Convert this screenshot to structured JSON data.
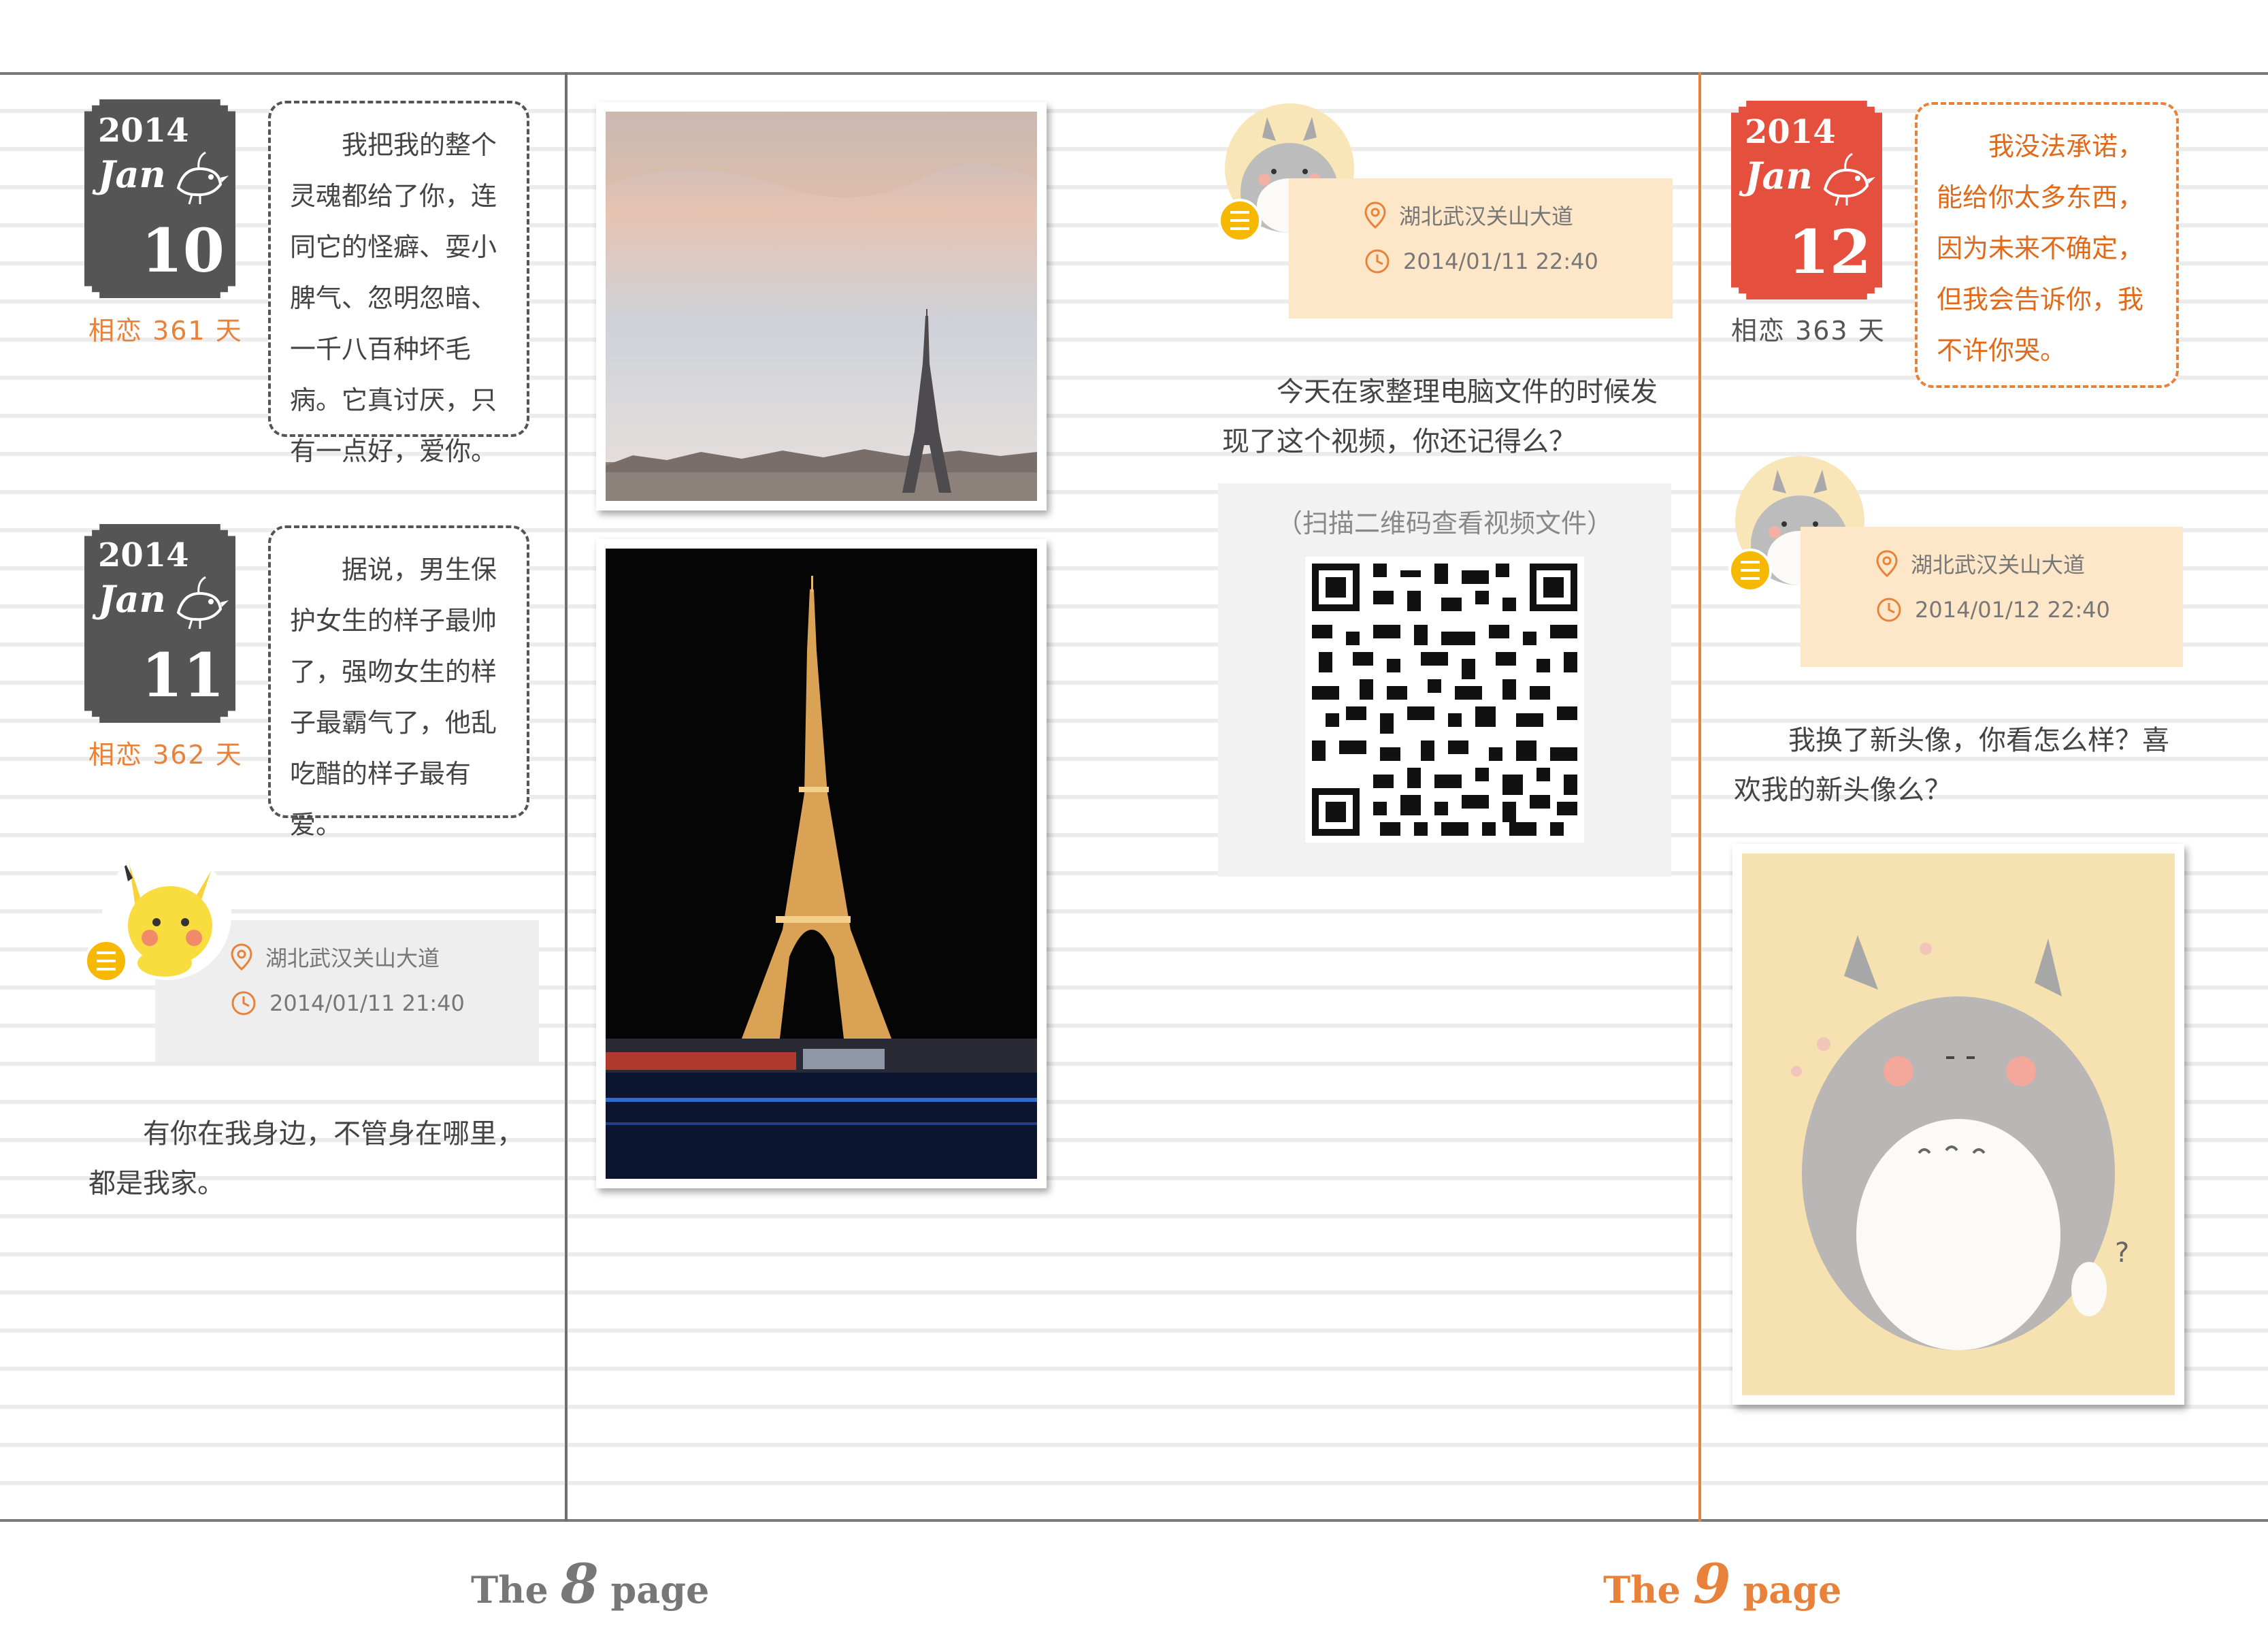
{
  "left_page": {
    "entries": [
      {
        "year": "2014",
        "month": "Jan",
        "day": "10",
        "love_days": "相恋 361 天",
        "note": "我把我的整个灵魂都给了你，连同它的怪癖、耍小脾气、忽明忽暗、一千八百种坏毛病。它真讨厌，只有一点好，爱你。"
      },
      {
        "year": "2014",
        "month": "Jan",
        "day": "11",
        "love_days": "相恋 362 天",
        "note": "据说，男生保护女生的样子最帅了，强吻女生的样子最霸气了，他乱吃醋的样子最有爱。"
      }
    ],
    "post": {
      "location": "湖北武汉关山大道",
      "time": "2014/01/11   21:40",
      "text": "有你在我身边，不管身在哪里，都是我家。"
    }
  },
  "middle": {
    "post": {
      "location": "湖北武汉关山大道",
      "time": "2014/01/11   22:40",
      "text": "今天在家整理电脑文件的时候发现了这个视频，你还记得么？",
      "qr_caption": "（扫描二维码查看视频文件）"
    }
  },
  "right_page": {
    "entry": {
      "year": "2014",
      "month": "Jan",
      "day": "12",
      "love_days": "相恋 363 天",
      "note": "我没法承诺，能给你太多东西，因为未来不确定，但我会告诉你，我不许你哭。"
    },
    "post": {
      "location": "湖北武汉关山大道",
      "time": "2014/01/12   22:40",
      "text": "我换了新头像，你看怎么样？喜欢我的新头像么？"
    }
  },
  "footer": {
    "page8": {
      "prefix": "The",
      "num": "8",
      "suffix": "page"
    },
    "page9": {
      "prefix": "The",
      "num": "9",
      "suffix": "page"
    }
  },
  "colors": {
    "accent": "#e8823a",
    "badge_red": "#e4503d",
    "badge_dark": "#555555",
    "peach_card": "#fde7c8",
    "gray_card": "#eeeeee"
  }
}
